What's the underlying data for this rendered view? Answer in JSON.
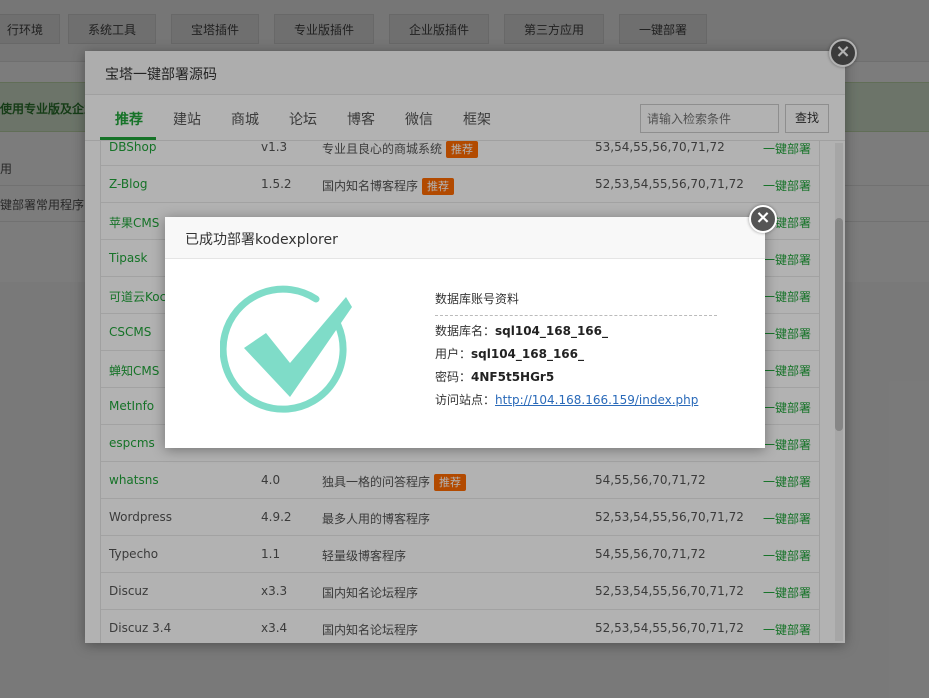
{
  "background": {
    "top_tabs": [
      "行环境",
      "系统工具",
      "宝塔插件",
      "专业版插件",
      "企业版插件",
      "第三方应用",
      "一键部署"
    ],
    "notice_text": "使用专业版及企业",
    "row1_text": "用",
    "row2_text": "键部署常用程序!"
  },
  "modal": {
    "title": "宝塔一键部署源码",
    "tabs": [
      "推荐",
      "建站",
      "商城",
      "论坛",
      "博客",
      "微信",
      "框架"
    ],
    "search_placeholder": "请输入检索条件",
    "search_button": "查找",
    "badge_label": "推荐",
    "rows": [
      {
        "name": "DBShop",
        "version": "v1.3",
        "desc": "专业且良心的商城系统",
        "badge": true,
        "php": "53,54,55,56,70,71,72",
        "action": "一键部署"
      },
      {
        "name": "Z-Blog",
        "version": "1.5.2",
        "desc": "国内知名博客程序",
        "badge": true,
        "php": "52,53,54,55,56,70,71,72",
        "action": "一键部署"
      },
      {
        "name": "苹果CMS",
        "version": "",
        "desc": "",
        "badge": false,
        "php": "",
        "action": "一键部署"
      },
      {
        "name": "Tipask",
        "version": "",
        "desc": "",
        "badge": false,
        "php": "",
        "action": "一键部署"
      },
      {
        "name": "可道云Koc",
        "version": "",
        "desc": "",
        "badge": false,
        "php": "",
        "action": "一键部署"
      },
      {
        "name": "CSCMS",
        "version": "",
        "desc": "",
        "badge": false,
        "php": "",
        "action": "一键部署"
      },
      {
        "name": "蝉知CMS",
        "version": "",
        "desc": "",
        "badge": false,
        "php": "",
        "action": "一键部署"
      },
      {
        "name": "MetInfo",
        "version": "",
        "desc": "",
        "badge": false,
        "php": "",
        "action": "一键部署"
      },
      {
        "name": "espcms",
        "version": "",
        "desc": "",
        "badge": false,
        "php": "",
        "action": "一键部署"
      },
      {
        "name": "whatsns",
        "version": "4.0",
        "desc": "独具一格的问答程序",
        "badge": true,
        "php": "54,55,56,70,71,72",
        "action": "一键部署"
      },
      {
        "name": "Wordpress",
        "version": "4.9.2",
        "desc": "最多人用的博客程序",
        "badge": false,
        "php": "52,53,54,55,56,70,71,72",
        "action": "一键部署"
      },
      {
        "name": "Typecho",
        "version": "1.1",
        "desc": "轻量级博客程序",
        "badge": false,
        "php": "54,55,56,70,71,72",
        "action": "一键部署"
      },
      {
        "name": "Discuz",
        "version": "x3.3",
        "desc": "国内知名论坛程序",
        "badge": false,
        "php": "52,53,54,55,56,70,71,72",
        "action": "一键部署"
      },
      {
        "name": "Discuz 3.4",
        "version": "x3.4",
        "desc": "国内知名论坛程序",
        "badge": false,
        "php": "52,53,54,55,56,70,71,72",
        "action": "一键部署"
      }
    ]
  },
  "dialog": {
    "title": "已成功部署kodexplorer",
    "heading": "数据库账号资料",
    "db_name_label": "数据库名：",
    "db_name": "sql104_168_166_",
    "user_label": "用户：",
    "user": "sql104_168_166_",
    "password_label": "密码：",
    "password": "4NF5t5HGr5",
    "site_label": "访问站点：",
    "site_url": "http://104.168.166.159/index.php"
  },
  "colors": {
    "accent": "#20a53a",
    "badge": "#ff6a00",
    "check": "#7fdcc8",
    "link": "#2a6ab9"
  },
  "icons": {
    "close": "close-icon",
    "success": "check-circle-icon"
  }
}
